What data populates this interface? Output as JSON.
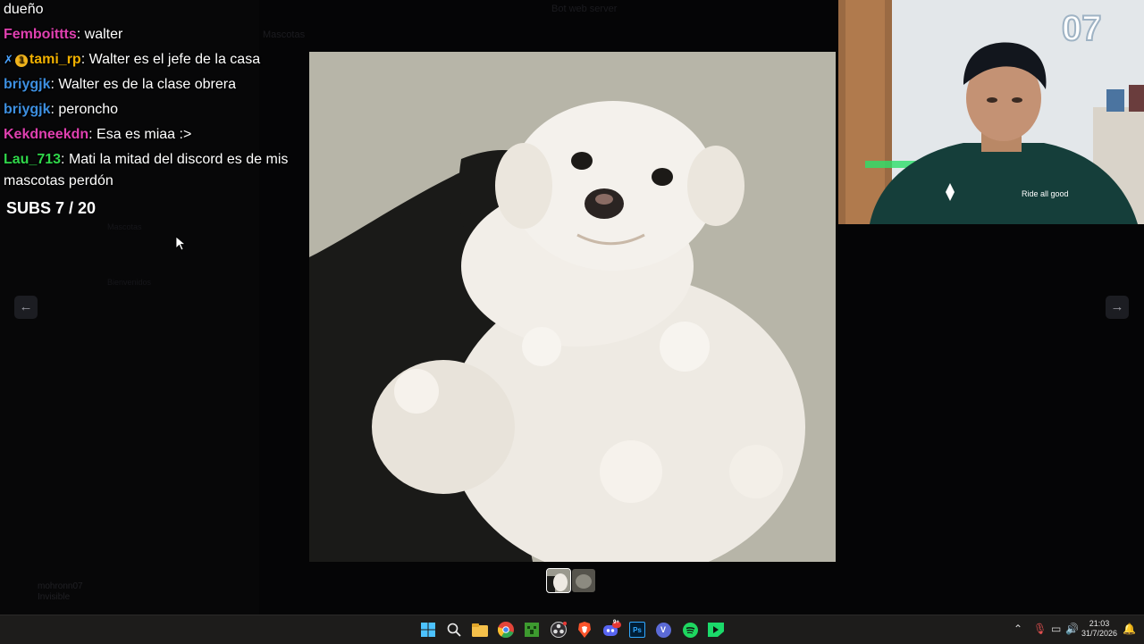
{
  "chat": {
    "lines": [
      {
        "name": "",
        "name_color": "#ffffff",
        "message": "dueño"
      },
      {
        "name": "Femboittts",
        "name_color": "#e040b0",
        "message": ": walter"
      },
      {
        "name": "tami_rp",
        "name_color": "#f0b000",
        "message": ": Walter es el jefe de la casa"
      },
      {
        "name": "briygjk",
        "name_color": "#3d8fe0",
        "message": ": Walter es de la clase obrera"
      },
      {
        "name": "briygjk",
        "name_color": "#3d8fe0",
        "message": ": peroncho"
      },
      {
        "name": "Kekdneekdn",
        "name_color": "#e040b0",
        "message": ": Esa es miaa :>"
      },
      {
        "name": "Lau_713",
        "name_color": "#2fd64a",
        "message": ": Mati la mitad del discord es de mis"
      },
      {
        "name": "",
        "name_color": "#ffffff",
        "message": "mascotas perdón"
      }
    ],
    "badge_coin": "1"
  },
  "subs_goal": "SUBS 7 / 20",
  "background_app": {
    "header_text": "Bot web server",
    "channel_title": "Mascotas",
    "sidebar_channel": "Mascotas",
    "category_label": "Bienvenidos",
    "username": "mohronn07",
    "user_status": "Invisible"
  },
  "viewer": {
    "prev_icon": "arrow-left-icon",
    "next_icon": "arrow-right-icon",
    "prev_glyph": "←",
    "next_glyph": "→",
    "thumbnail_count": 2
  },
  "webcam": {
    "logo_text": "07",
    "shirt_text": "Ride all good"
  },
  "taskbar": {
    "icons": [
      "windows-start-icon",
      "search-icon",
      "file-explorer-icon",
      "chrome-icon",
      "minecraft-icon",
      "obs-icon",
      "brave-icon",
      "discord-icon",
      "photoshop-icon",
      "vivaldi-icon",
      "spotify-icon",
      "green-app-icon"
    ],
    "ps_label": "Ps",
    "v_label": "V",
    "discord_badge": "9+",
    "time": "21:03",
    "date": "31/7/2026"
  },
  "colors": {
    "accent_blue": "#3d8fe0",
    "accent_pink": "#e040b0",
    "accent_green": "#2fd64a",
    "accent_gold": "#f0b000"
  }
}
